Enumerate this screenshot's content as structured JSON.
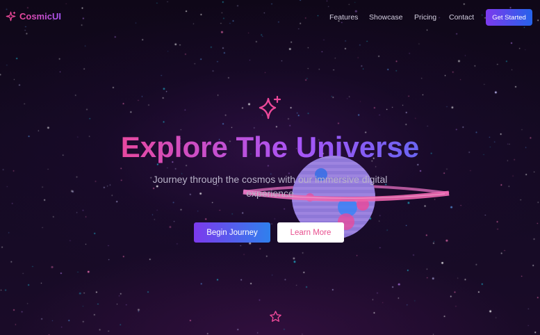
{
  "nav": {
    "brand": "CosmicUI",
    "brand_icon": "sparkle-icon",
    "links": [
      {
        "label": "Features"
      },
      {
        "label": "Showcase"
      },
      {
        "label": "Pricing"
      },
      {
        "label": "Contact"
      }
    ],
    "cta_label": "Get Started"
  },
  "hero": {
    "icon": "sparkles-icon",
    "title": "Explore The Universe",
    "subtitle": "Journey through the cosmos with our immersive digital experience",
    "primary_label": "Begin Journey",
    "secondary_label": "Learn More",
    "bottom_icon": "star-outline-icon"
  },
  "colors": {
    "background": "#120a1e",
    "accent_pink": "#ec4899",
    "accent_purple": "#a855f7",
    "accent_blue": "#3b82f6",
    "planet_stripe": "#a98ee8"
  }
}
